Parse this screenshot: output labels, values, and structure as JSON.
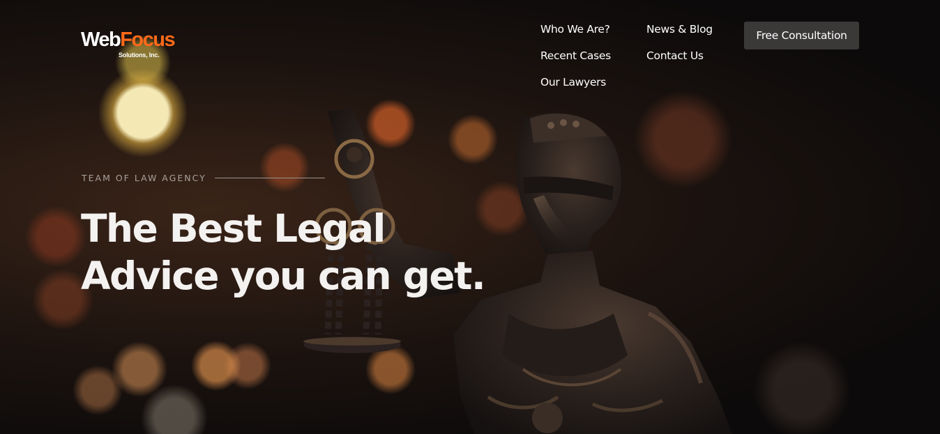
{
  "brand": {
    "logo_word_1": "Web",
    "logo_word_2": "Focus",
    "logo_tagline": "Solutions, Inc.",
    "colors": {
      "logo_accent": "#ff6a1a",
      "cta_background": "#3b3838",
      "text": "#ffffff"
    }
  },
  "nav": {
    "items": [
      {
        "label": "Who We Are?"
      },
      {
        "label": "News & Blog"
      },
      {
        "label": "Recent Cases"
      },
      {
        "label": "Contact Us"
      },
      {
        "label": "Our Lawyers"
      }
    ],
    "cta_label": "Free Consultation"
  },
  "hero": {
    "eyebrow": "TEAM OF LAW AGENCY",
    "headline_line_1": "The Best Legal",
    "headline_line_2": "Advice you can get.",
    "background_image": "lady-justice-statue-bokeh"
  }
}
